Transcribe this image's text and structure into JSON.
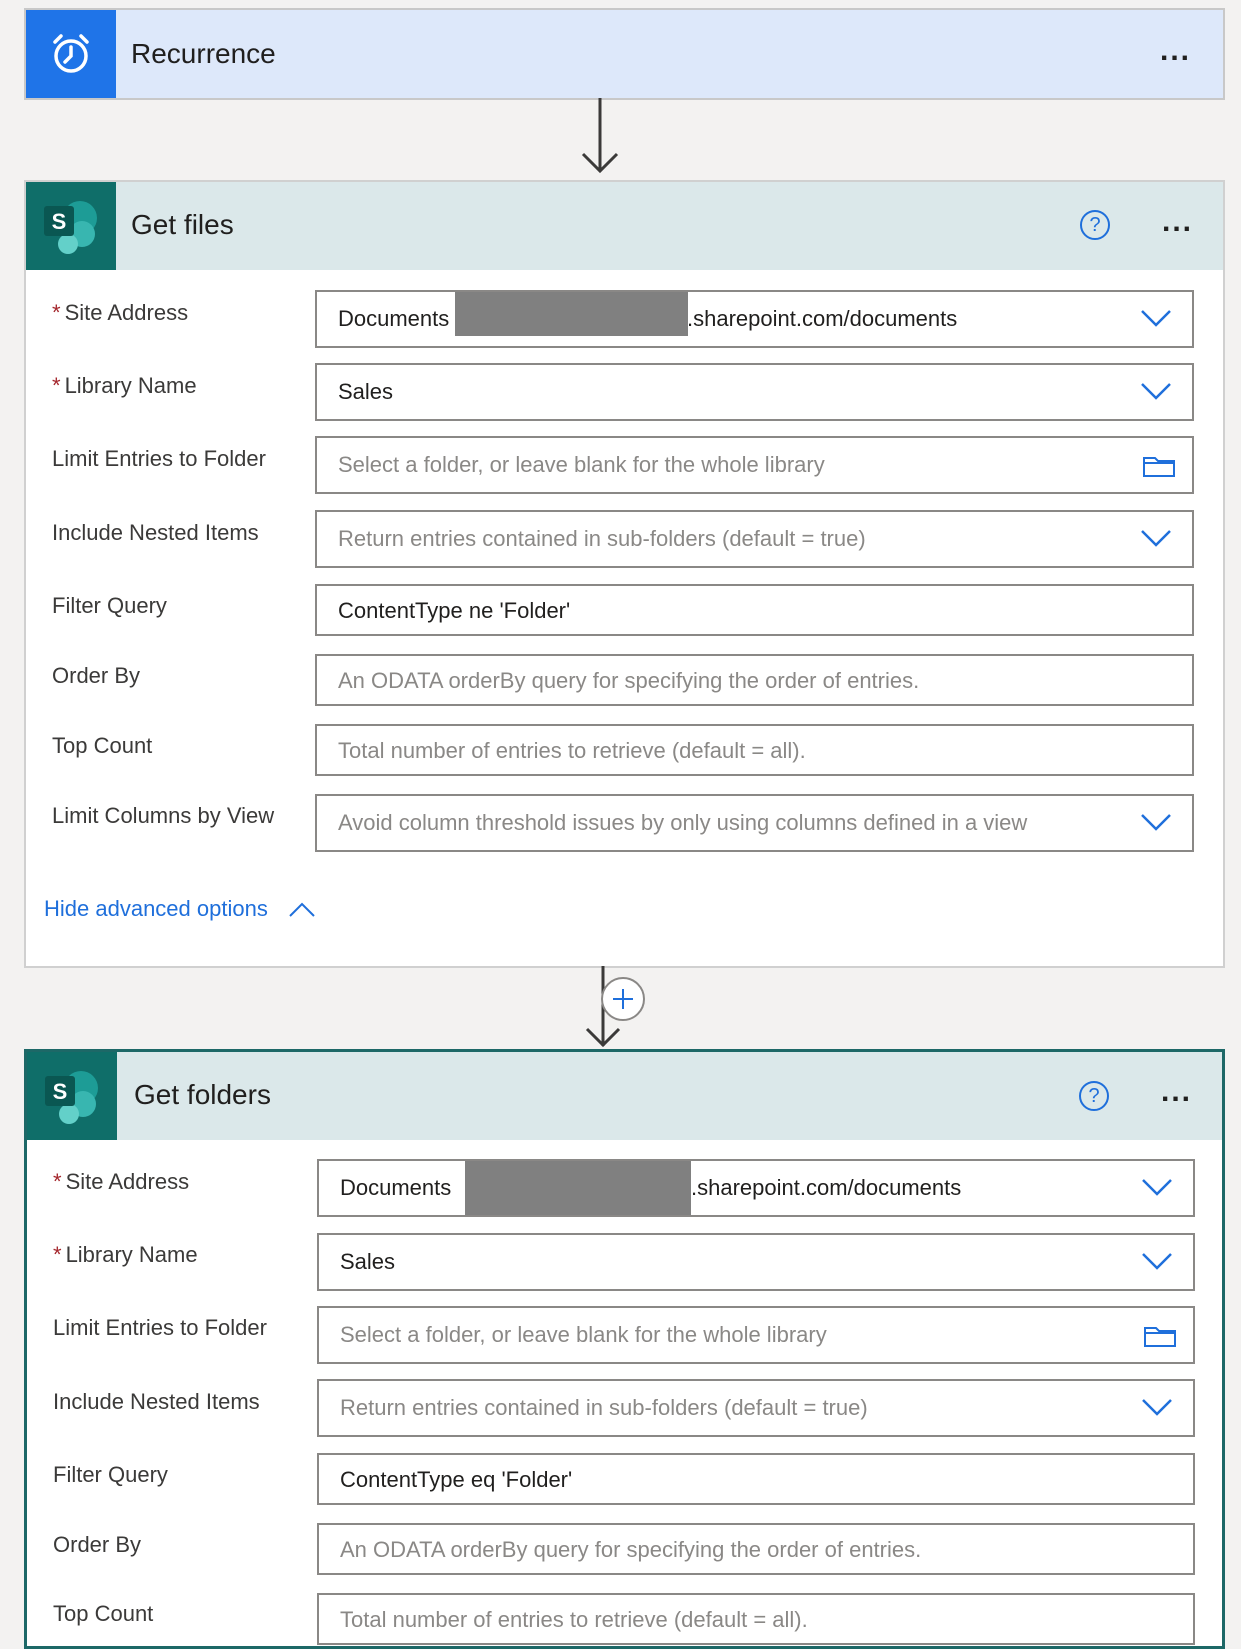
{
  "recurrence": {
    "title": "Recurrence"
  },
  "get_files": {
    "title": "Get files",
    "site_address_label": "Site Address",
    "site_address_prefix": "Documents",
    "site_address_suffix": ".sharepoint.com/documents",
    "library_name_label": "Library Name",
    "library_name_value": "Sales",
    "limit_folder_label": "Limit Entries to Folder",
    "limit_folder_placeholder": "Select a folder, or leave blank for the whole library",
    "nested_label": "Include Nested Items",
    "nested_placeholder": "Return entries contained in sub-folders (default = true)",
    "filter_label": "Filter Query",
    "filter_value": "ContentType ne 'Folder'",
    "order_label": "Order By",
    "order_placeholder": "An ODATA orderBy query for specifying the order of entries.",
    "top_label": "Top Count",
    "top_placeholder": "Total number of entries to retrieve (default = all).",
    "view_label": "Limit Columns by View",
    "view_placeholder": "Avoid column threshold issues by only using columns defined in a view",
    "advanced_link": "Hide advanced options"
  },
  "get_folders": {
    "title": "Get folders",
    "site_address_label": "Site Address",
    "site_address_prefix": "Documents",
    "site_address_suffix": ".sharepoint.com/documents",
    "library_name_label": "Library Name",
    "library_name_value": "Sales",
    "limit_folder_label": "Limit Entries to Folder",
    "limit_folder_placeholder": "Select a folder, or leave blank for the whole library",
    "nested_label": "Include Nested Items",
    "nested_placeholder": "Return entries contained in sub-folders (default = true)",
    "filter_label": "Filter Query",
    "filter_value": "ContentType eq 'Folder'",
    "order_label": "Order By",
    "order_placeholder": "An ODATA orderBy query for specifying the order of entries.",
    "top_label": "Top Count",
    "top_placeholder": "Total number of entries to retrieve (default = all)."
  },
  "required_mark": "*",
  "more_options": "...",
  "help_glyph": "?",
  "colors": {
    "accent": "#1f6fdb",
    "sharepoint": "#0f6e69",
    "recurrence": "#1f74e8"
  }
}
